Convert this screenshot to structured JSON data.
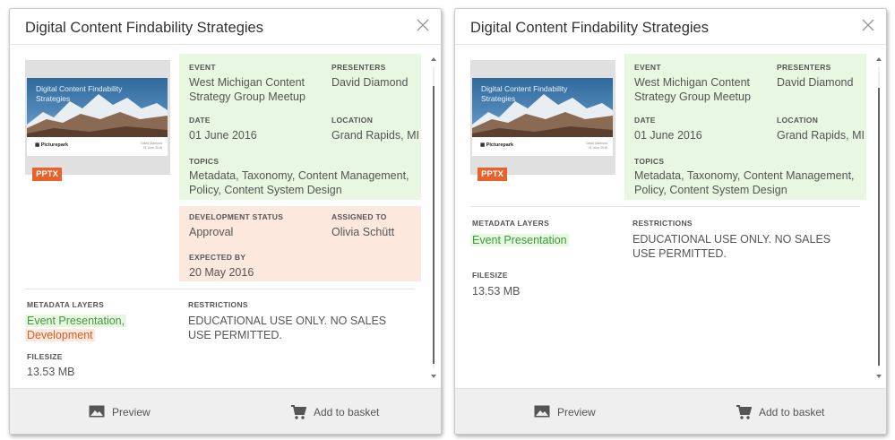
{
  "panels": [
    {
      "title": "Digital Content Findability Strategies",
      "thumbnail": {
        "slide_title": "Digital Content Findability Strategies",
        "logo": "Picturepark",
        "meta_line1": "David Diamond",
        "meta_line2": "01 June 2016",
        "badge": "PPTX"
      },
      "event": {
        "event_label": "EVENT",
        "event_value": "West Michigan Content Strategy Group Meetup",
        "presenters_label": "PRESENTERS",
        "presenters_value": "David Diamond",
        "date_label": "DATE",
        "date_value": "01 June 2016",
        "location_label": "LOCATION",
        "location_value": "Grand Rapids, MI",
        "topics_label": "TOPICS",
        "topics_value": "Metadata, Taxonomy, Content Management, Policy, Content System Design"
      },
      "status": {
        "dev_label": "DEVELOPMENT STATUS",
        "dev_value": "Approval",
        "assigned_label": "ASSIGNED TO",
        "assigned_value": "Olivia Schütt",
        "expected_label": "EXPECTED BY",
        "expected_value": "20 May 2016"
      },
      "meta": {
        "layers_label": "METADATA LAYERS",
        "layer_1": "Event Presentation,",
        "layer_2": "Development",
        "restrictions_label": "RESTRICTIONS",
        "restrictions_value": "EDUCATIONAL USE ONLY. NO SALES USE PERMITTED.",
        "filesize_label": "FILESIZE",
        "filesize_value": "13.53 MB"
      },
      "scroll_position": 0.82
    },
    {
      "title": "Digital Content Findability Strategies",
      "thumbnail": {
        "slide_title": "Digital Content Findability Strategies",
        "logo": "Picturepark",
        "meta_line1": "David Diamond",
        "meta_line2": "01 June 2016",
        "badge": "PPTX"
      },
      "event": {
        "event_label": "EVENT",
        "event_value": "West Michigan Content Strategy Group Meetup",
        "presenters_label": "PRESENTERS",
        "presenters_value": "David Diamond",
        "date_label": "DATE",
        "date_value": "01 June 2016",
        "location_label": "LOCATION",
        "location_value": "Grand Rapids, MI",
        "topics_label": "TOPICS",
        "topics_value": "Metadata, Taxonomy, Content Management, Policy, Content System Design"
      },
      "meta": {
        "layers_label": "METADATA LAYERS",
        "layer_1": "Event Presentation",
        "restrictions_label": "RESTRICTIONS",
        "restrictions_value": "EDUCATIONAL USE ONLY. NO SALES USE PERMITTED.",
        "filesize_label": "FILESIZE",
        "filesize_value": "13.53 MB"
      },
      "scroll_position": 0.9
    }
  ],
  "footer": {
    "preview_label": "Preview",
    "preview_icon": "image-icon",
    "basket_label": "Add to basket",
    "basket_icon": "cart-icon"
  },
  "colors": {
    "event_bg": "#e7f7e1",
    "status_bg": "#fde8dd",
    "badge": "#e8622c",
    "green_text": "#3f9b3a",
    "orange_text": "#d35f22"
  }
}
